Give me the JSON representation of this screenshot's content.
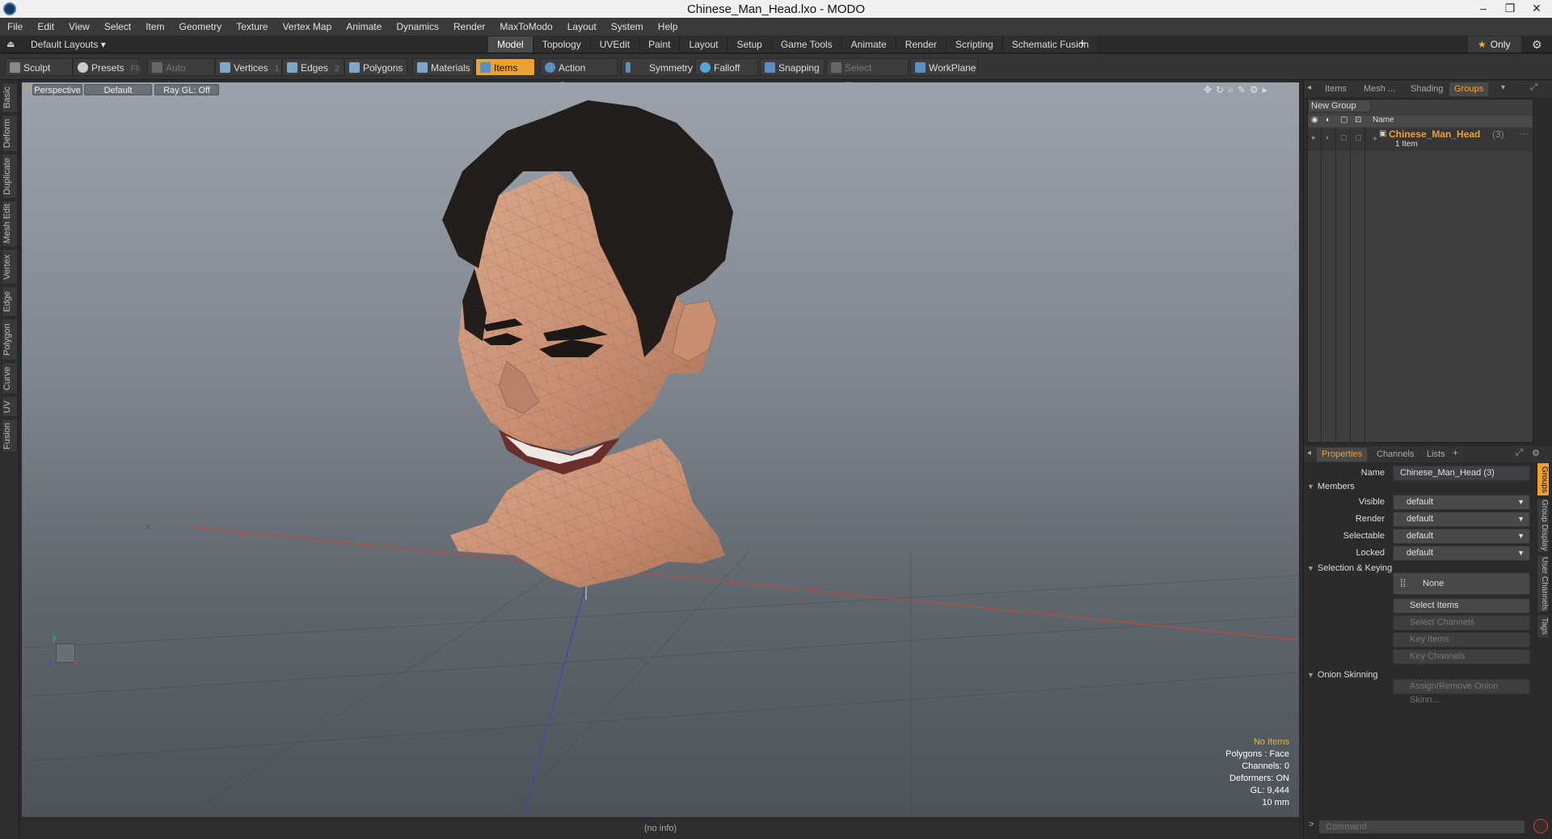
{
  "window": {
    "title": "Chinese_Man_Head.lxo - MODO"
  },
  "menu": [
    "File",
    "Edit",
    "View",
    "Select",
    "Item",
    "Geometry",
    "Texture",
    "Vertex Map",
    "Animate",
    "Dynamics",
    "Render",
    "MaxToModo",
    "Layout",
    "System",
    "Help"
  ],
  "layoutbar": {
    "layouts_label": "Default Layouts ▾",
    "tabs": [
      "Model",
      "Topology",
      "UVEdit",
      "Paint",
      "Layout",
      "Setup",
      "Game Tools",
      "Animate",
      "Render",
      "Scripting",
      "Schematic Fusion"
    ],
    "active_tab": "Model",
    "only_label": "Only"
  },
  "toolbar": {
    "sculpt": "Sculpt",
    "presets": "Presets",
    "presets_key": "F6",
    "auto_select": "Auto Select",
    "vertices": "Vertices",
    "vertices_key": "1",
    "edges": "Edges",
    "edges_key": "2",
    "polygons": "Polygons",
    "materials": "Materials",
    "items": "Items",
    "action_center": "Action Center",
    "symmetry": "Symmetry",
    "falloff": "Falloff",
    "snapping": "Snapping",
    "select_through": "Select Through",
    "workplane": "WorkPlane"
  },
  "left_tabs": [
    "Basic",
    "Deform",
    "Duplicate",
    "Mesh Edit",
    "Vertex",
    "Edge",
    "Polygon",
    "Curve",
    "UV",
    "Fusion"
  ],
  "viewport": {
    "view": "Perspective",
    "shading": "Default",
    "raygl": "Ray GL: Off",
    "hud": {
      "no_items": "No Items",
      "polygons": "Polygons : Face",
      "channels": "Channels: 0",
      "deformers": "Deformers: ON",
      "gl": "GL: 9,444",
      "scale": "10 mm"
    },
    "axis_y": "y",
    "axis_x": "x",
    "axis_z": "z"
  },
  "status": "(no info)",
  "right_panel": {
    "top_tabs": [
      "Items",
      "Mesh ...",
      "Shading",
      "Groups"
    ],
    "active_top_tab": "Groups",
    "new_group": "New Group",
    "name_header": "Name",
    "group": {
      "name": "Chinese_Man_Head",
      "count": "(3)",
      "sub": "1 Item"
    },
    "bottom_tabs": [
      "Properties",
      "Channels",
      "Lists"
    ],
    "active_bottom_tab": "Properties",
    "properties": {
      "name_label": "Name",
      "name_value": "Chinese_Man_Head (3)",
      "members_section": "Members",
      "visible_label": "Visible",
      "visible_value": "default",
      "render_label": "Render",
      "render_value": "default",
      "selectable_label": "Selectable",
      "selectable_value": "default",
      "locked_label": "Locked",
      "locked_value": "default",
      "sel_keying_section": "Selection & Keying",
      "none_btn": "None",
      "select_items": "Select Items",
      "select_channels": "Select Channels",
      "key_items": "Key Items",
      "key_channels": "Key Channels",
      "onion_section": "Onion Skinning",
      "assign_onion": "Assign/Remove Onion Skinn..."
    },
    "side_tabs": [
      "Groups",
      "Group Display",
      "User Channels",
      "Tags"
    ],
    "command_placeholder": "Command"
  }
}
